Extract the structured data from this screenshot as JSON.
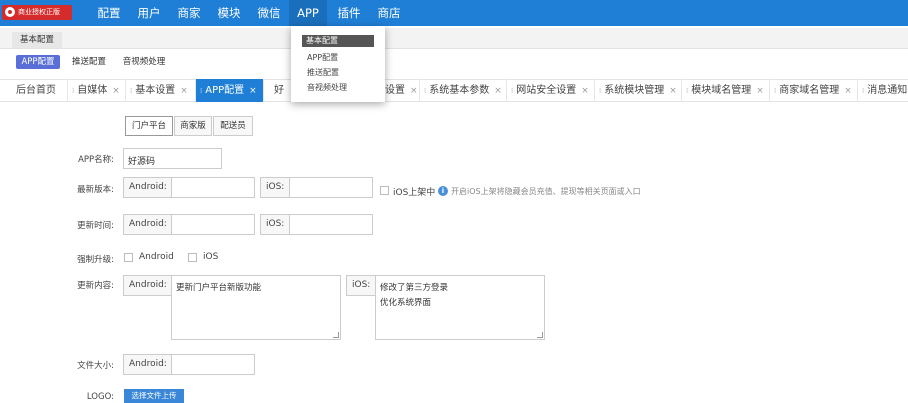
{
  "brand": {
    "logo_text": "商业授权正版"
  },
  "nav": [
    "配置",
    "用户",
    "商家",
    "模块",
    "微信",
    "APP",
    "插件",
    "商店"
  ],
  "dropdown": {
    "header": "基本配置",
    "items": [
      "APP配置",
      "推送配置",
      "音视频处理"
    ]
  },
  "subnav": {
    "basic": "基本配置",
    "items": [
      "APP配置",
      "推送配置",
      "音视频处理"
    ]
  },
  "tabs": [
    "后台首页",
    "自媒体",
    "基本设置",
    "APP配置",
    "好",
    "设置",
    "系统基本参数",
    "网站安全设置",
    "系统模块管理",
    "模块域名管理",
    "商家域名管理",
    "消息通知"
  ],
  "tab_close": "×",
  "segments": [
    "门户平台",
    "商家版",
    "配送员"
  ],
  "form": {
    "app_name": {
      "label": "APP名称:",
      "value": "好源码"
    },
    "version": {
      "label": "最新版本:",
      "android": "Android:",
      "ios": "iOS:",
      "ios_shelf": "iOS上架中",
      "hint": "开启iOS上架将隐藏会员充值、提现等相关页面或入口"
    },
    "update_time": {
      "label": "更新时间:",
      "android": "Android:",
      "ios": "iOS:"
    },
    "force": {
      "label": "强制升级:",
      "android": "Android",
      "ios": "iOS"
    },
    "content": {
      "label": "更新内容:",
      "android": "Android:",
      "android_lines": [
        "更新门户平台新版功能"
      ],
      "ios": "iOS:",
      "ios_lines": [
        "修改了第三方登录",
        "优化系统界面"
      ]
    },
    "size": {
      "label": "文件大小:",
      "android": "Android:"
    },
    "logo": {
      "label": "LOGO:",
      "upload": "选择文件上传"
    }
  },
  "colors": {
    "nav_bg": "#1f7fd6",
    "active_tab": "#1f7fd6",
    "active_sub": "#5a6ed8",
    "logo_bg": "#d52b2b"
  }
}
